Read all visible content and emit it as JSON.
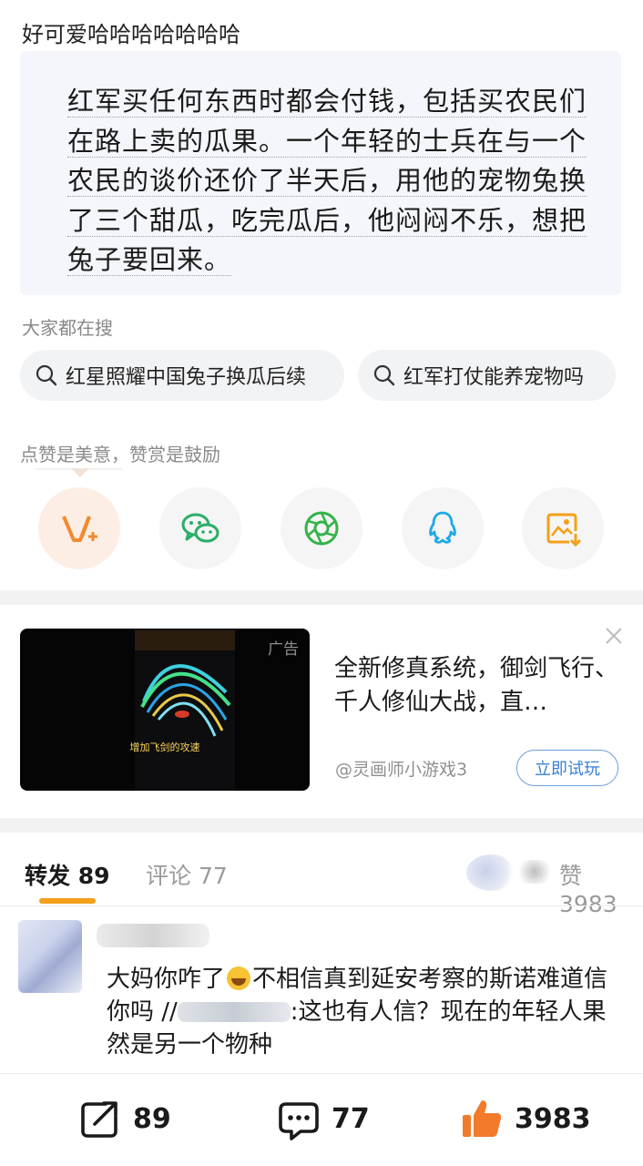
{
  "post": {
    "title": "好可爱哈哈哈哈哈哈哈",
    "quote": "红军买任何东西时都会付钱，包括买农民们在路上卖的瓜果。一个年轻的士兵在与一个农民的谈价还价了半天后，用他的宠物兔换了三个甜瓜，吃完瓜后，他闷闷不乐，想把兔子要回来。"
  },
  "search": {
    "heading": "大家都在搜",
    "chips": [
      "红星照耀中国兔子换瓜后续",
      "红军打仗能养宠物吗"
    ]
  },
  "reward": {
    "heading": "点赞是美意，赞赏是鼓励",
    "buttons": [
      "v-plus-icon",
      "wechat-icon",
      "moments-icon",
      "qq-icon",
      "save-image-icon"
    ]
  },
  "ad": {
    "tag": "广告",
    "caption": "增加飞剑的攻速",
    "text": "全新修真系统，御剑飞行、千人修仙大战，直…",
    "source": "@灵画师小游戏3",
    "cta": "立即试玩"
  },
  "tabs": {
    "repost_label": "转发",
    "repost_count": "89",
    "comment_label": "评论",
    "comment_count": "77",
    "like_label": "赞",
    "like_count": "3983",
    "accent_color": "#f3a01a"
  },
  "comment": {
    "text_before_emoji": "大妈你咋了",
    "text_after_emoji": "不相信真到延安考察的斯诺难道信你吗 //",
    "text_end": ":这也有人信？现在的年轻人果然是另一个物种"
  },
  "actions": {
    "repost": "89",
    "comment": "77",
    "like": "3983",
    "like_color": "#f37a2a"
  }
}
